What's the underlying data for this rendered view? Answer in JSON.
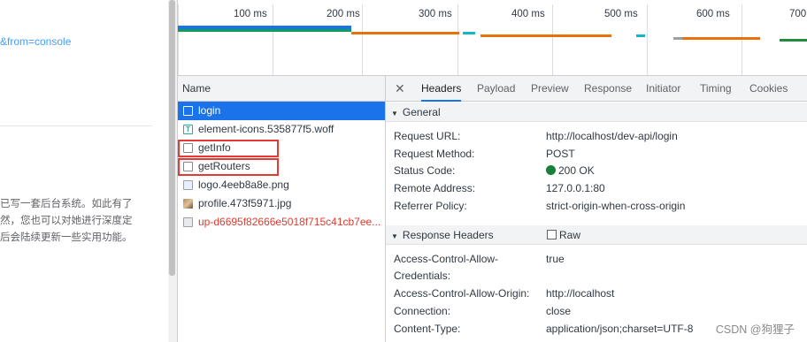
{
  "page": {
    "link_text": "&from=console",
    "paragraph_lines": [
      "已写一套后台系统。如此有了",
      "然，您也可以对她进行深度定",
      "后会陆续更新一些实用功能。"
    ]
  },
  "overview": {
    "ticks": [
      "100 ms",
      "200 ms",
      "300 ms",
      "400 ms",
      "500 ms",
      "600 ms",
      "700"
    ]
  },
  "network": {
    "name_header": "Name",
    "requests": [
      {
        "name": "login",
        "icon": "document-icon",
        "state": "selected"
      },
      {
        "name": "element-icons.535877f5.woff",
        "icon": "font-icon",
        "state": "normal"
      },
      {
        "name": "getInfo",
        "icon": "document-icon",
        "state": "normal"
      },
      {
        "name": "getRouters",
        "icon": "document-icon",
        "state": "normal"
      },
      {
        "name": "logo.4eeb8a8e.png",
        "icon": "image-icon",
        "state": "normal"
      },
      {
        "name": "profile.473f5971.jpg",
        "icon": "photo-icon",
        "state": "normal"
      },
      {
        "name": "up-d6695f82666e5018f715c41cb7ee...",
        "icon": "script-icon",
        "state": "error"
      }
    ]
  },
  "detail": {
    "close_glyph": "✕",
    "tabs": [
      "Headers",
      "Payload",
      "Preview",
      "Response",
      "Initiator",
      "Timing",
      "Cookies"
    ],
    "active_tab": "Headers",
    "general_title": "General",
    "general": [
      {
        "key": "Request URL:",
        "value": "http://localhost/dev-api/login"
      },
      {
        "key": "Request Method:",
        "value": "POST"
      },
      {
        "key": "Status Code:",
        "value": "200 OK"
      },
      {
        "key": "Remote Address:",
        "value": "127.0.0.1:80"
      },
      {
        "key": "Referrer Policy:",
        "value": "strict-origin-when-cross-origin"
      }
    ],
    "response_title": "Response Headers",
    "raw_label": "Raw",
    "response_headers": [
      {
        "key": "Access-Control-Allow-",
        "value": "true"
      },
      {
        "key": "Credentials:",
        "value": ""
      },
      {
        "key": "Access-Control-Allow-Origin:",
        "value": "http://localhost"
      },
      {
        "key": "Connection:",
        "value": "close"
      },
      {
        "key": "Content-Type:",
        "value": "application/json;charset=UTF-8"
      }
    ]
  },
  "watermark": "CSDN @狗狸子",
  "colors": {
    "selected": "#1a73e8",
    "error": "#dc3b2f",
    "highlight_box": "#e53935",
    "status_ok": "#188038"
  }
}
